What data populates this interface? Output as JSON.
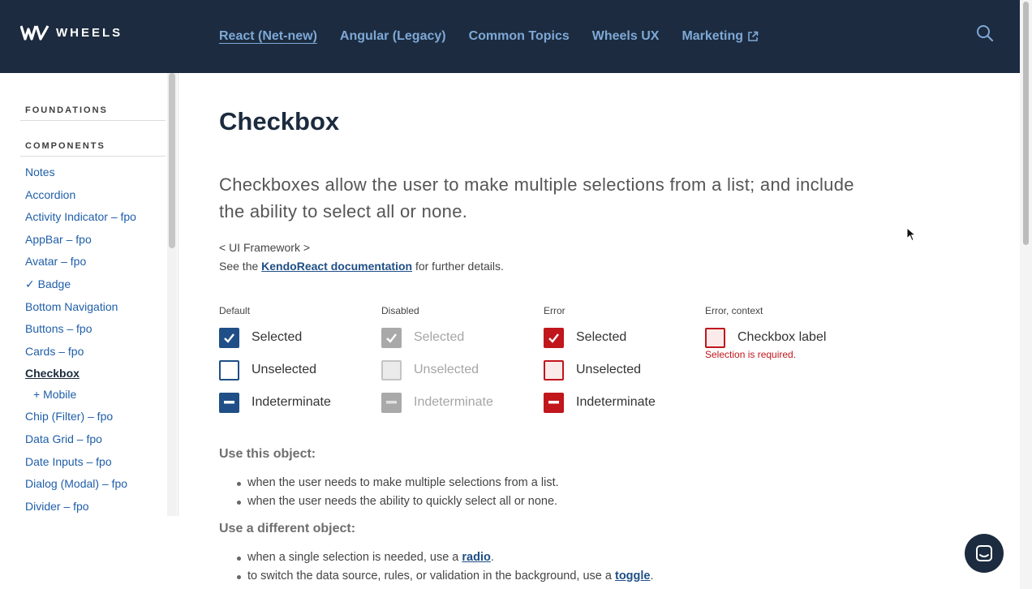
{
  "header": {
    "logo_text": "WHEELS",
    "nav": [
      {
        "label": "React (Net-new)",
        "active": true
      },
      {
        "label": "Angular (Legacy)"
      },
      {
        "label": "Common Topics"
      },
      {
        "label": "Wheels UX"
      },
      {
        "label": "Marketing",
        "external": true
      }
    ],
    "search_icon": "search-icon"
  },
  "sidebar": {
    "sections": [
      "FOUNDATIONS",
      "COMPONENTS"
    ],
    "items": [
      {
        "label": "Notes"
      },
      {
        "label": "Accordion"
      },
      {
        "label": "Activity Indicator – fpo"
      },
      {
        "label": "AppBar – fpo"
      },
      {
        "label": "Avatar – fpo"
      },
      {
        "label": "✓ Badge"
      },
      {
        "label": "Bottom Navigation"
      },
      {
        "label": "Buttons – fpo"
      },
      {
        "label": "Cards – fpo"
      },
      {
        "label": "Checkbox",
        "current": true
      },
      {
        "label": "+ Mobile",
        "sub": true
      },
      {
        "label": "Chip (Filter) – fpo"
      },
      {
        "label": "Data Grid – fpo"
      },
      {
        "label": "Date Inputs – fpo"
      },
      {
        "label": "Dialog (Modal) – fpo"
      },
      {
        "label": "Divider – fpo"
      }
    ]
  },
  "main": {
    "title": "Checkbox",
    "lead": "Checkboxes allow the user to make multiple selections from a list; and include the ability to select all or none.",
    "framework_line": "< UI Framework >",
    "see_prefix": "See the ",
    "see_link": "KendoReact documentation",
    "see_suffix": " for further details.",
    "states": [
      {
        "heading": "Default",
        "rows": [
          "Selected",
          "Unselected",
          "Indeterminate"
        ]
      },
      {
        "heading": "Disabled",
        "rows": [
          "Selected",
          "Unselected",
          "Indeterminate"
        ]
      },
      {
        "heading": "Error",
        "rows": [
          "Selected",
          "Unselected",
          "Indeterminate"
        ]
      },
      {
        "heading": "Error, context",
        "rows": [
          "Checkbox label"
        ],
        "error_message": "Selection is required."
      }
    ],
    "use_title": "Use this object:",
    "use_items": [
      "when the user needs to make multiple selections from a list.",
      "when the user needs the ability to quickly select all or none."
    ],
    "diff_title": "Use a different object:",
    "diff_items": [
      {
        "prefix": "when a single selection is needed, use a ",
        "link": "radio",
        "suffix": "."
      },
      {
        "prefix": "to switch the data source, rules, or validation in the background, use a ",
        "link": "toggle",
        "suffix": "."
      }
    ]
  },
  "colors": {
    "header_bg": "#1c2b3f",
    "nav_link": "#7ea8d6",
    "checkbox_default": "#1f4f86",
    "checkbox_disabled": "#a9a9a9",
    "checkbox_error": "#c0161c"
  },
  "chat_icon": "chat-icon"
}
